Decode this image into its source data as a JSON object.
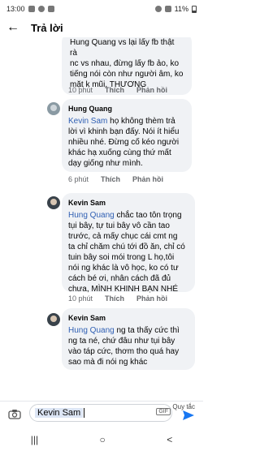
{
  "status_bar": {
    "time": "13:00",
    "battery": "11%"
  },
  "header": {
    "title": "Trả lời"
  },
  "comments": [
    {
      "lines": [
        "Hung Quang vs lại lấy fb thật rà",
        "nc vs nhau, đừng lấy fb ảo, ko",
        "tiếng nói còn như người âm, ko",
        "mặt k mũi, THƯƠNG"
      ],
      "time": "10 phút",
      "like": "Thích",
      "reply": "Phản hồi"
    },
    {
      "author": "Hung Quang",
      "mention": "Kevin Sam",
      "lines_first": " họ không thèm trả",
      "lines": [
        "lời vì khinh bạn đấy. Nói ít hiểu",
        "nhiều nhé. Đừng cố kéo người",
        "khác hạ xuống cùng thứ mất",
        "dạy giống như mình."
      ],
      "time": "6 phút",
      "like": "Thích",
      "reply": "Phản hồi"
    },
    {
      "author": "Kevin Sam",
      "mention": "Hung Quang",
      "lines_first": " chắc tao tôn trọng",
      "lines": [
        "tụi bây, tự tui bây vô cần tao",
        "trước, cả mấy chục cái cmt ng",
        "ta chỉ chăm chú tới đồ ăn, chỉ có",
        "tuin bây soi mói trong L họ,tôi",
        "nói ng khác là vô học, ko có tư",
        "cách bé ơi, nhân cách đã đủ",
        "chưa, MÌNH KHINH BẠN NHÉ"
      ],
      "time": "10 phút",
      "like": "Thích",
      "reply": "Phản hồi"
    },
    {
      "author": "Kevin Sam",
      "mention": "Hung Quang",
      "lines_first": " ng ta thấy cức thì",
      "lines": [
        "ng ta né, chứ đâu như tụi bây",
        "vào táp cức, thơm tho quá hay",
        "sao mà đi nói ng khác"
      ]
    }
  ],
  "composer": {
    "reply_note": "Quy tắc",
    "value": "Kevin Sam",
    "gif": "GIF"
  },
  "navbar": {
    "recents": "|||",
    "home": "○",
    "back": "<"
  }
}
